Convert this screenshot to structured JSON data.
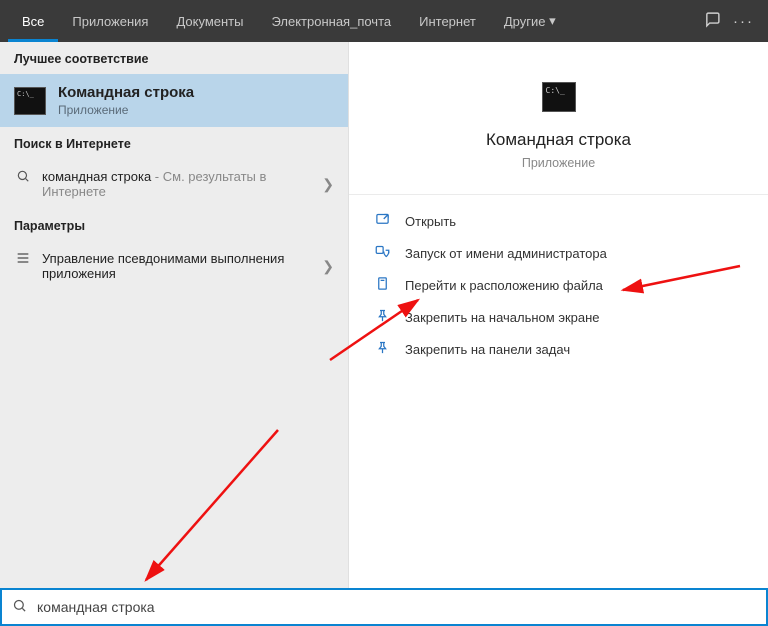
{
  "tabs": {
    "all": "Все",
    "apps": "Приложения",
    "docs": "Документы",
    "email": "Электронная_почта",
    "web": "Интернет",
    "more": "Другие"
  },
  "left": {
    "best_match_header": "Лучшее соответствие",
    "best_match": {
      "title": "Командная строка",
      "subtitle": "Приложение"
    },
    "web_header": "Поиск в Интернете",
    "web_item": {
      "term": "командная строка",
      "suffix": " - См. результаты в Интернете"
    },
    "params_header": "Параметры",
    "params_item": "Управление псевдонимами выполнения приложения"
  },
  "right": {
    "title": "Командная строка",
    "subtitle": "Приложение",
    "actions": {
      "open": "Открыть",
      "run_admin": "Запуск от имени администратора",
      "open_location": "Перейти к расположению файла",
      "pin_start": "Закрепить на начальном экране",
      "pin_taskbar": "Закрепить на панели задач"
    }
  },
  "search": {
    "value": "командная строка"
  }
}
